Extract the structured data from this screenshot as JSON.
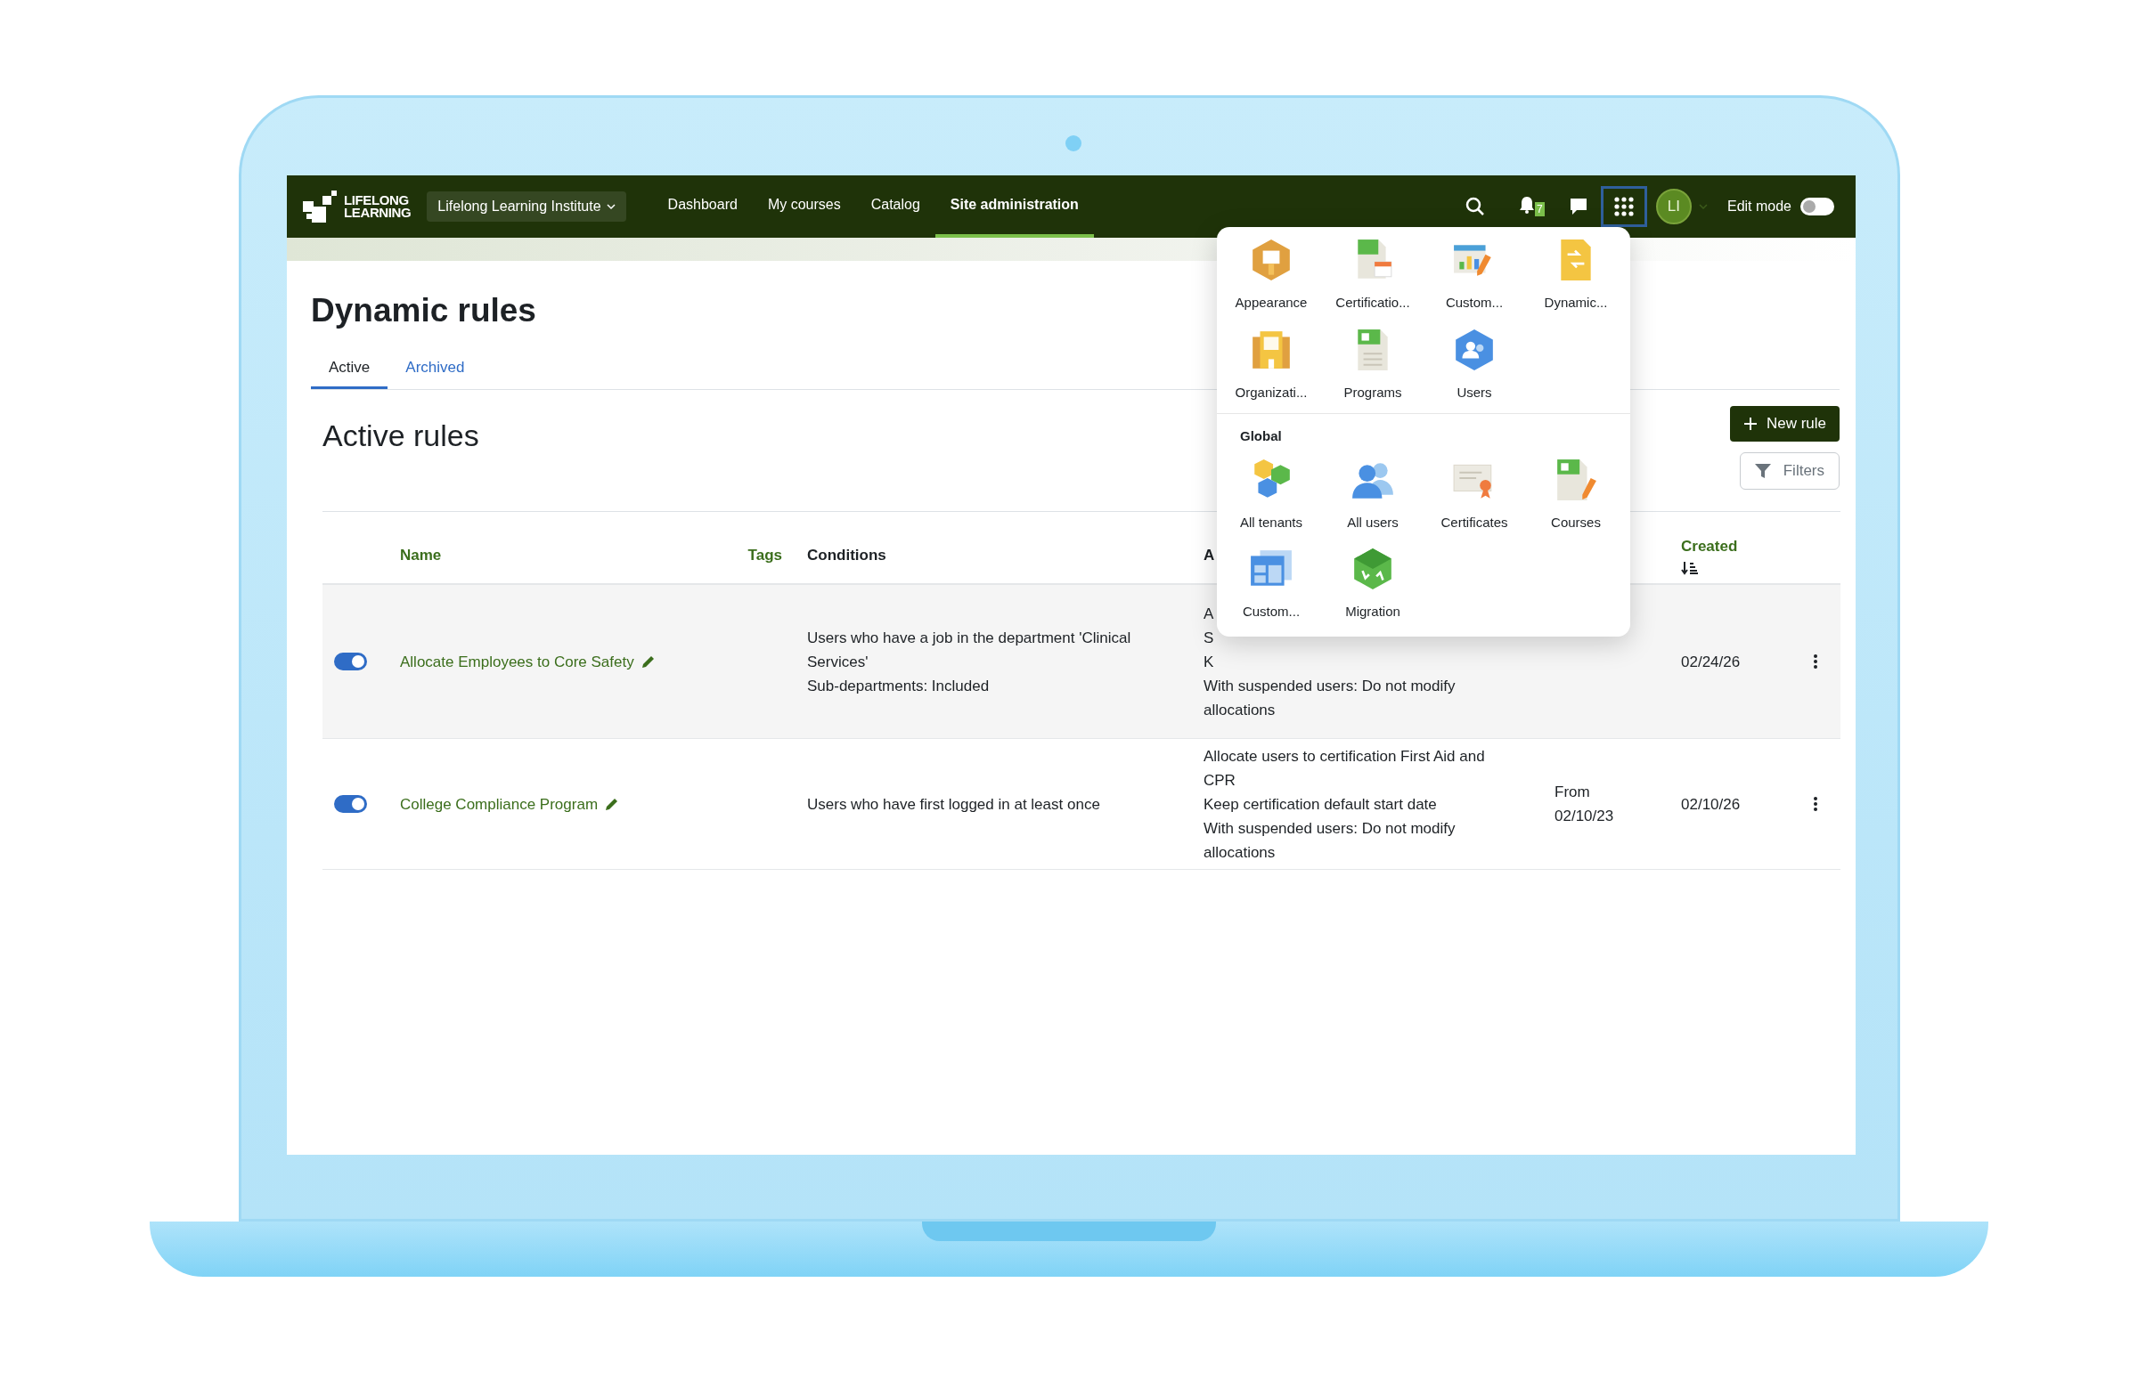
{
  "nav": {
    "logo_text": [
      "LIFELONG",
      "LEARNING"
    ],
    "tenant": "Lifelong Learning Institute",
    "links": [
      {
        "label": "Dashboard",
        "selected": false
      },
      {
        "label": "My courses",
        "selected": false
      },
      {
        "label": "Catalog",
        "selected": false
      },
      {
        "label": "Site administration",
        "selected": true
      }
    ],
    "notification_count": "7",
    "apps_button": {
      "selected": true
    },
    "avatar": "LI",
    "edit_mode": {
      "label": "Edit mode",
      "on": false
    }
  },
  "page": {
    "title": "Dynamic rules",
    "tabs": [
      {
        "label": "Active",
        "selected": true
      },
      {
        "label": "Archived",
        "selected": false
      }
    ],
    "heading": "Active rules",
    "new_button": "New rule",
    "filters_button": "Filters"
  },
  "table": {
    "columns": [
      {
        "label": "Name",
        "sortable": true
      },
      {
        "label": "Tags",
        "sortable": true
      },
      {
        "label": "Conditions",
        "sortable": false
      },
      {
        "label": "A",
        "sortable": false
      },
      {
        "label": "Created",
        "sortable": true
      }
    ],
    "rows": [
      {
        "enabled": true,
        "highlighted": true,
        "name": "Allocate Employees to Core Safety",
        "conditions": [
          "Users who have a job in the department 'Clinical Services'",
          "Sub-departments: Included"
        ],
        "actions": [
          "A",
          "S",
          "K",
          "With suspended users: Do not modify",
          "allocations"
        ],
        "created": "02/24/26"
      },
      {
        "enabled": true,
        "highlighted": false,
        "name": "College Compliance Program",
        "conditions": [
          "Users who have first logged in at least once"
        ],
        "actions": [
          "Allocate users to certification First Aid and CPR",
          "Keep certification default start date",
          "With suspended users: Do not modify allocations"
        ],
        "period": "From 02/10/23",
        "created": "02/10/26"
      }
    ]
  },
  "app_menu": {
    "sections": [
      {
        "items": [
          {
            "label": "Appearance"
          },
          {
            "label": "Certificatio..."
          },
          {
            "label": "Custom..."
          },
          {
            "label": "Dynamic..."
          },
          {
            "label": "Organizati..."
          },
          {
            "label": "Programs"
          },
          {
            "label": "Users"
          }
        ]
      },
      {
        "title": "Global",
        "items": [
          {
            "label": "All tenants"
          },
          {
            "label": "All users"
          },
          {
            "label": "Certificates"
          },
          {
            "label": "Courses"
          },
          {
            "label": "Custom..."
          },
          {
            "label": "Migration"
          }
        ]
      }
    ]
  }
}
